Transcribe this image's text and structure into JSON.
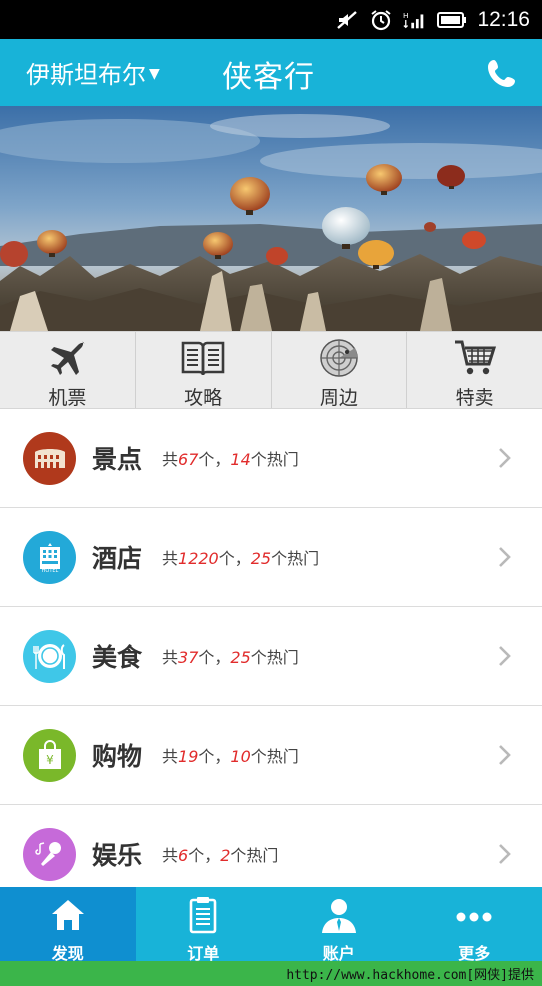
{
  "status_bar": {
    "time": "12:16",
    "icons": [
      "mute-icon",
      "alarm-icon",
      "signal-icon",
      "battery-icon"
    ]
  },
  "header": {
    "city": "伊斯坦布尔",
    "title": "侠客行",
    "phone_icon": "phone-icon"
  },
  "banner": {
    "slide_count": 4,
    "active_slide": 1
  },
  "quick_nav": [
    {
      "label": "机票",
      "icon": "airplane-icon"
    },
    {
      "label": "攻略",
      "icon": "book-icon"
    },
    {
      "label": "周边",
      "icon": "radar-icon"
    },
    {
      "label": "特卖",
      "icon": "shopping-cart-icon"
    }
  ],
  "list": [
    {
      "title": "景点",
      "icon": "colosseum-icon",
      "color": "#b0391c",
      "pre": "共",
      "count": "67",
      "mid": "个，",
      "hot": "14",
      "post": "个热门"
    },
    {
      "title": "酒店",
      "icon": "hotel-icon",
      "color": "#23a9d8",
      "pre": "共",
      "count": "1220",
      "mid": "个，",
      "hot": "25",
      "post": "个热门"
    },
    {
      "title": "美食",
      "icon": "plate-icon",
      "color": "#3fc7e8",
      "pre": "共",
      "count": "37",
      "mid": "个，",
      "hot": "25",
      "post": "个热门"
    },
    {
      "title": "购物",
      "icon": "shopping-bag-icon",
      "color": "#7ab82a",
      "pre": "共",
      "count": "19",
      "mid": "个，",
      "hot": "10",
      "post": "个热门"
    },
    {
      "title": "娱乐",
      "icon": "microphone-icon",
      "color": "#c66ad9",
      "pre": "共",
      "count": "6",
      "mid": "个，",
      "hot": "2",
      "post": "个热门"
    }
  ],
  "tabs": [
    {
      "label": "发现",
      "icon": "home-icon",
      "active": true
    },
    {
      "label": "订单",
      "icon": "clipboard-icon",
      "active": false
    },
    {
      "label": "账户",
      "icon": "user-icon",
      "active": false
    },
    {
      "label": "更多",
      "icon": "more-icon",
      "active": false
    }
  ],
  "footer": {
    "watermark": "http://www.hackhome.com[网侠]提供"
  },
  "colors": {
    "accent": "#18b3d8",
    "tab_active": "#0f8fd0",
    "highlight_number": "#e12c2c",
    "footer": "#3bb54a"
  }
}
